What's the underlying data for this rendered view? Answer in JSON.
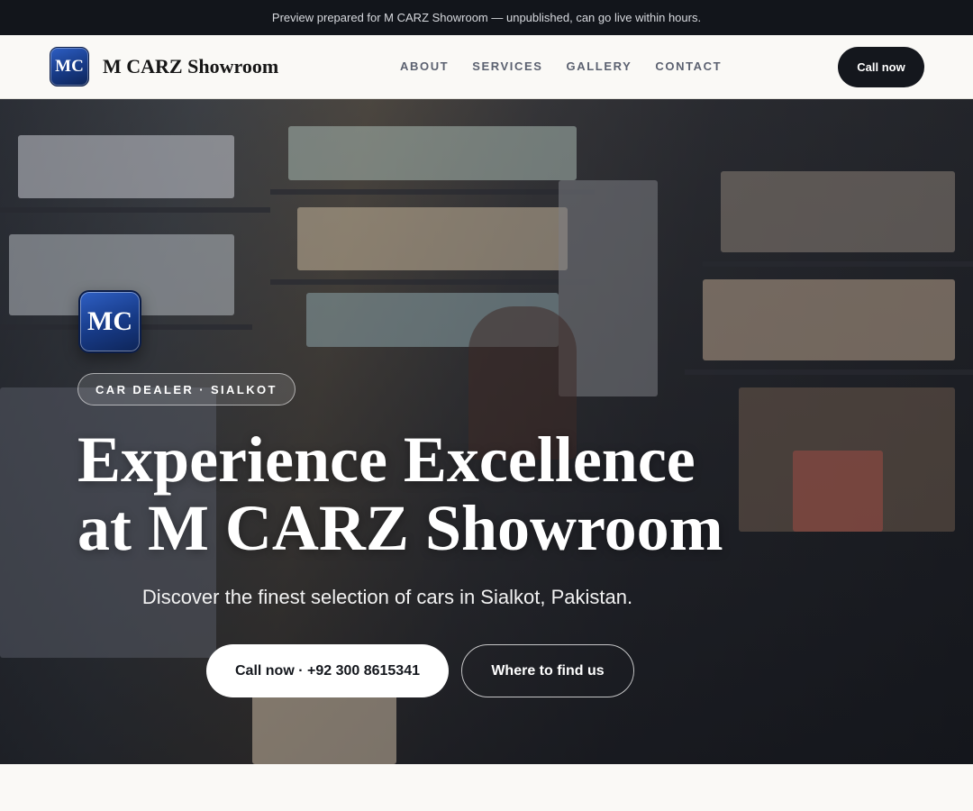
{
  "topbar": {
    "text": "Preview prepared for M CARZ Showroom — unpublished, can go live within hours."
  },
  "nav": {
    "logo_initials": "MC",
    "brand": "M CARZ Showroom",
    "items": [
      {
        "label": "ABOUT"
      },
      {
        "label": "SERVICES"
      },
      {
        "label": "GALLERY"
      },
      {
        "label": "CONTACT"
      }
    ],
    "call_label": "Call now"
  },
  "hero": {
    "badge_initials": "MC",
    "pill": "CAR DEALER · SIALKOT",
    "headline": "Experience Excellence at M CARZ Showroom",
    "subline": "Discover the finest selection of cars in Sialkot, Pakistan.",
    "primary_cta": "Call now · +92 300 8615341",
    "secondary_cta": "Where to find us"
  },
  "colors": {
    "topbar_bg": "#12151b",
    "nav_bg": "#faf9f6",
    "brand_blue": "#173a86",
    "dark_button": "#14171d"
  }
}
